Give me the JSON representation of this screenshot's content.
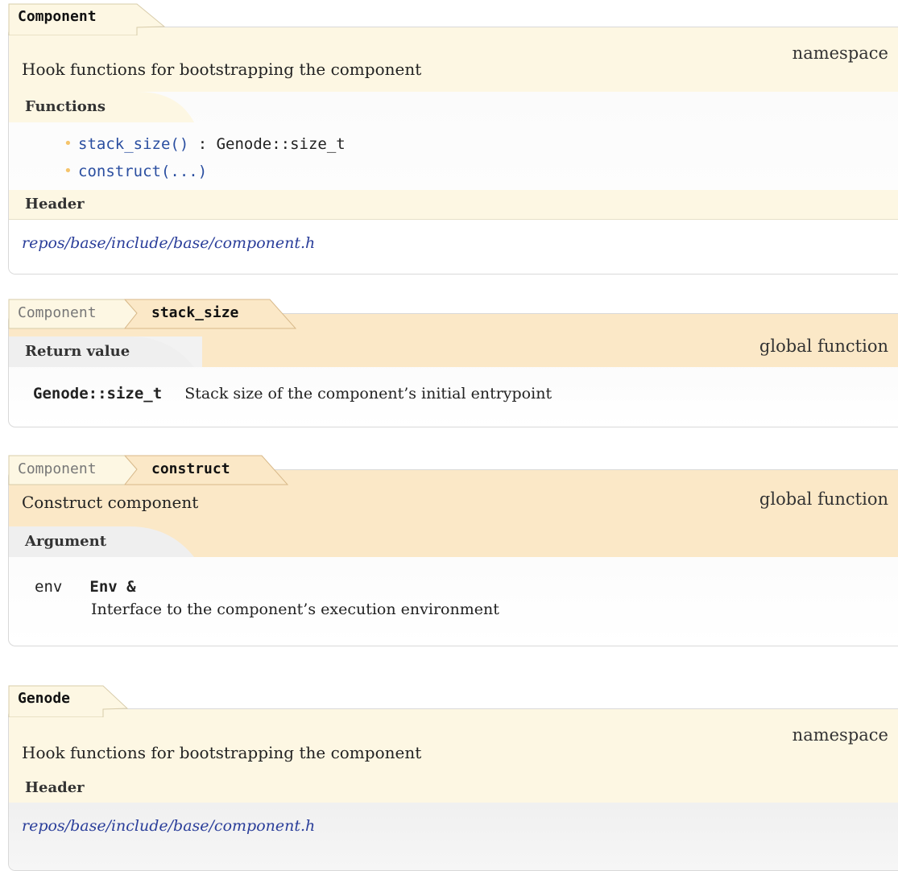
{
  "component_ns": {
    "title": "Component",
    "kind": "namespace",
    "brief": "Hook functions for bootstrapping the component",
    "functions_label": "Functions",
    "functions": [
      {
        "name": "stack_size()",
        "ret": " : Genode::size_t"
      },
      {
        "name": "construct(...)",
        "ret": ""
      }
    ],
    "header_label": "Header",
    "header_path": "repos/base/include/base/component.h"
  },
  "stack_size": {
    "crumb_parent": "Component",
    "crumb_name": "stack_size",
    "kind": "global function",
    "return_label": "Return value",
    "return_type": "Genode::size_t",
    "return_desc": "Stack size of the component’s initial entrypoint"
  },
  "construct": {
    "crumb_parent": "Component",
    "crumb_name": "construct",
    "kind": "global function",
    "brief": "Construct component",
    "argument_label": "Argument",
    "arg_name": "env",
    "arg_type": "Env &",
    "arg_desc": "Interface to the component’s execution environment"
  },
  "genode_ns": {
    "title": "Genode",
    "kind": "namespace",
    "brief": "Hook functions for bootstrapping the component",
    "header_label": "Header",
    "header_path": "repos/base/include/base/component.h"
  },
  "colors": {
    "namespace_bg": "#fdf7e3",
    "function_bg": "#fbe8c7",
    "link": "#2a4ea0",
    "bullet": "#f5c46b"
  }
}
